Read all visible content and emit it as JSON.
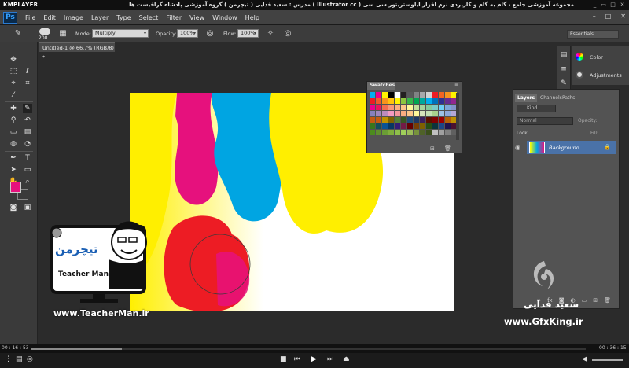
{
  "player": {
    "logo": "KMPLAYER",
    "title": "مجموعه آموزشی جامع ، گام به گام و کاربردی نرم افزار ایلوستریتور سی سی ( Illustrator cc )   مدرس : سعید فدایی ( تیچرمن ) گروه آموزشی پادشاه گرافیست ها",
    "controls": [
      "_",
      "▭",
      "□",
      "✕"
    ],
    "time_left": "00 : 16 : 53",
    "time_right": "00 : 36 : 15"
  },
  "photoshop": {
    "logo": "Ps",
    "menus": [
      "File",
      "Edit",
      "Image",
      "Layer",
      "Type",
      "Select",
      "Filter",
      "View",
      "Window",
      "Help"
    ],
    "window_controls": [
      "–",
      "□",
      "✕"
    ],
    "options": {
      "brush_size": "200",
      "mode_label": "Mode:",
      "mode_value": "Multiply",
      "opacity_label": "Opacity:",
      "opacity_value": "100%",
      "flow_label": "Flow:",
      "flow_value": "100%",
      "workspace": "Essentials"
    },
    "document_tab": "Untitled-1 @ 66.7% (RGB/8) *",
    "dock": [
      {
        "label": "Color",
        "icon": "color-icon"
      },
      {
        "label": "Adjustments",
        "icon": "adjustments-icon"
      }
    ],
    "swatches_panel": {
      "title": "Swatches",
      "colors": [
        "#00aeef",
        "#ec008c",
        "#fff200",
        "#000000",
        "#ffffff",
        "#231f20",
        "#58595b",
        "#808285",
        "#a7a9ac",
        "#d1d3d4",
        "#ed1c24",
        "#f26522",
        "#f7941d",
        "#fff200",
        "#ed1c24",
        "#f15a29",
        "#f7941d",
        "#ffc20e",
        "#fff200",
        "#8dc63f",
        "#39b54a",
        "#00a651",
        "#00a99d",
        "#00aeef",
        "#0072bc",
        "#2e3192",
        "#662d91",
        "#92278f",
        "#ec008c",
        "#ed145b",
        "#f26c4f",
        "#f69679",
        "#fbad80",
        "#fdc689",
        "#fff799",
        "#c4df9b",
        "#a3d39c",
        "#82ca9c",
        "#7accc8",
        "#6dcff6",
        "#7da7d9",
        "#8393ca",
        "#8781bd",
        "#a186be",
        "#bd8cbf",
        "#f49ac1",
        "#f5989d",
        "#f9ad81",
        "#fdc68a",
        "#fff79a",
        "#d7e4bd",
        "#c5e0b4",
        "#a9d18e",
        "#9dc3e6",
        "#8faadc",
        "#b4a7d6",
        "#c45911",
        "#c55a11",
        "#bf9000",
        "#7f6000",
        "#538135",
        "#385723",
        "#1f4e79",
        "#203864",
        "#3c1f5e",
        "#5b0f00",
        "#7f0000",
        "#990000",
        "#b45f06",
        "#bf9000",
        "#38761d",
        "#134f5c",
        "#0b5394",
        "#073763",
        "#351c75",
        "#741b47",
        "#660000",
        "#783f04",
        "#7f6000",
        "#274e13",
        "#0c343d",
        "#1c4587",
        "#20124d",
        "#4c1130",
        "#4c8c1e",
        "#5f8f2e",
        "#6b9e35",
        "#7fae3c",
        "#8fbf4a",
        "#a0cf5a",
        "#9bbb59",
        "#77933c",
        "#4f6228",
        "#3b4f1c",
        "#c0c0c0",
        "#a0a0a0",
        "#808080",
        "#606060"
      ]
    },
    "layers_panel": {
      "tabs": [
        "Layers",
        "Channels",
        "Paths"
      ],
      "kind_filter": "Kind",
      "blend_mode": "Normal",
      "opacity_label": "Opacity:",
      "fill_label": "Fill:",
      "lock_label": "Lock:",
      "layer_name": "Background",
      "footer_icons": [
        "link-icon",
        "fx-icon",
        "mask-icon",
        "adjustment-layer-icon",
        "group-icon",
        "new-layer-icon",
        "trash-icon"
      ]
    },
    "foreground_color": "#e6117d",
    "background_color": "#ffffff"
  },
  "canvas_colors": {
    "yellow": "#ffef00",
    "magenta": "#e6117d",
    "cyan": "#00a5e2",
    "red": "#ed1c24"
  },
  "watermarks": {
    "teacher_url": "www.TeacherMan.ir",
    "teacher_logo": "تیچرمن",
    "teacher_name": "Teacher Man",
    "gfx_name": "سعید فدایی",
    "gfx_url": "www.GfxKing.ir"
  }
}
